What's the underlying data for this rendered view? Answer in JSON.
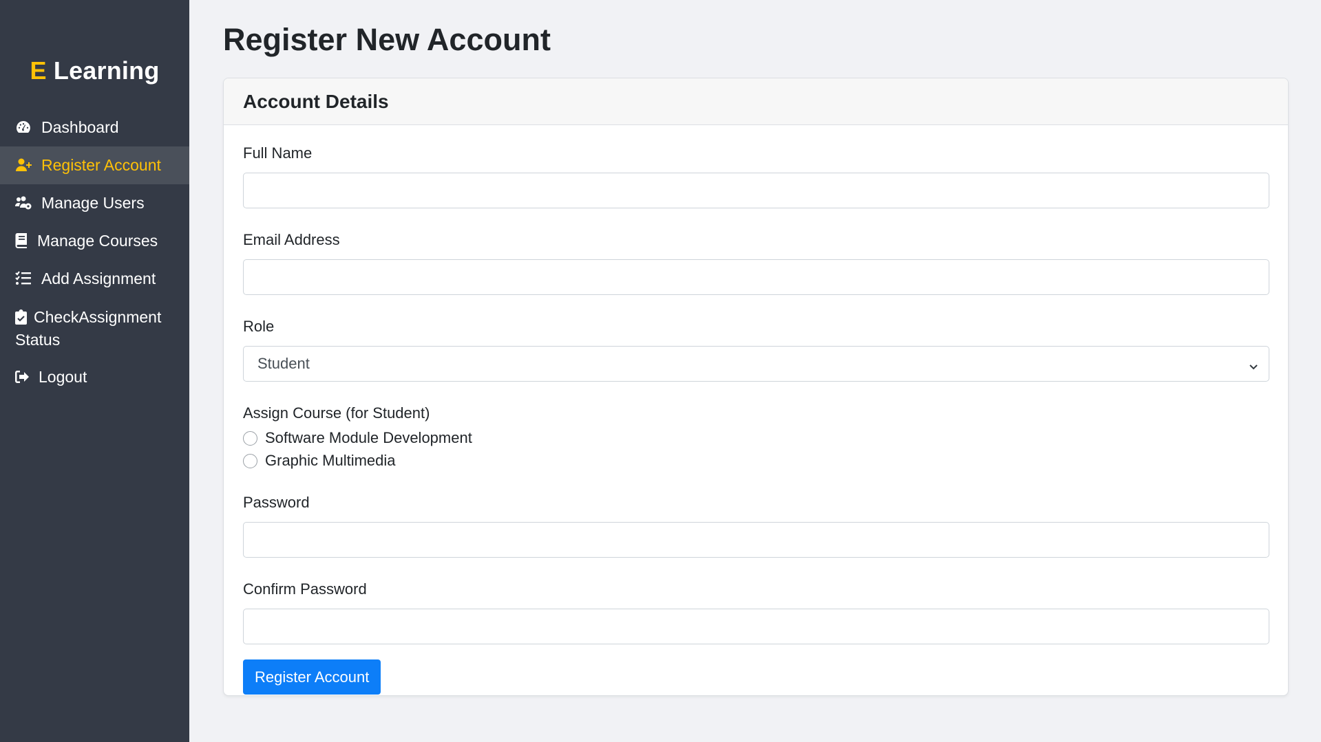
{
  "sidebar": {
    "brand_accent": "E",
    "brand_text": "Learning",
    "items": [
      {
        "label": "Dashboard",
        "icon": "gauge-icon",
        "active": false
      },
      {
        "label": "Register Account",
        "icon": "user-plus-icon",
        "active": true
      },
      {
        "label": "Manage Users",
        "icon": "users-gear-icon",
        "active": false
      },
      {
        "label": "Manage Courses",
        "icon": "book-icon",
        "active": false
      },
      {
        "label": "Add Assignment",
        "icon": "list-check-icon",
        "active": false
      },
      {
        "label": "CheckAssignment Status",
        "icon": "clipboard-check-icon",
        "active": false
      },
      {
        "label": "Logout",
        "icon": "logout-icon",
        "active": false
      }
    ]
  },
  "page": {
    "title": "Register New Account"
  },
  "form": {
    "card_title": "Account Details",
    "full_name_label": "Full Name",
    "full_name_value": "",
    "email_label": "Email Address",
    "email_value": "",
    "role_label": "Role",
    "role_selected": "Student",
    "assign_course_label": "Assign Course (for Student)",
    "courses": [
      {
        "label": "Software Module Development",
        "checked": false
      },
      {
        "label": "Graphic Multimedia",
        "checked": false
      }
    ],
    "password_label": "Password",
    "confirm_password_label": "Confirm Password",
    "submit_label": "Register Account"
  },
  "colors": {
    "sidebar_bg": "#343a46",
    "accent": "#ffc107",
    "primary_button": "#0d7ef8",
    "page_bg": "#f1f2f5"
  }
}
